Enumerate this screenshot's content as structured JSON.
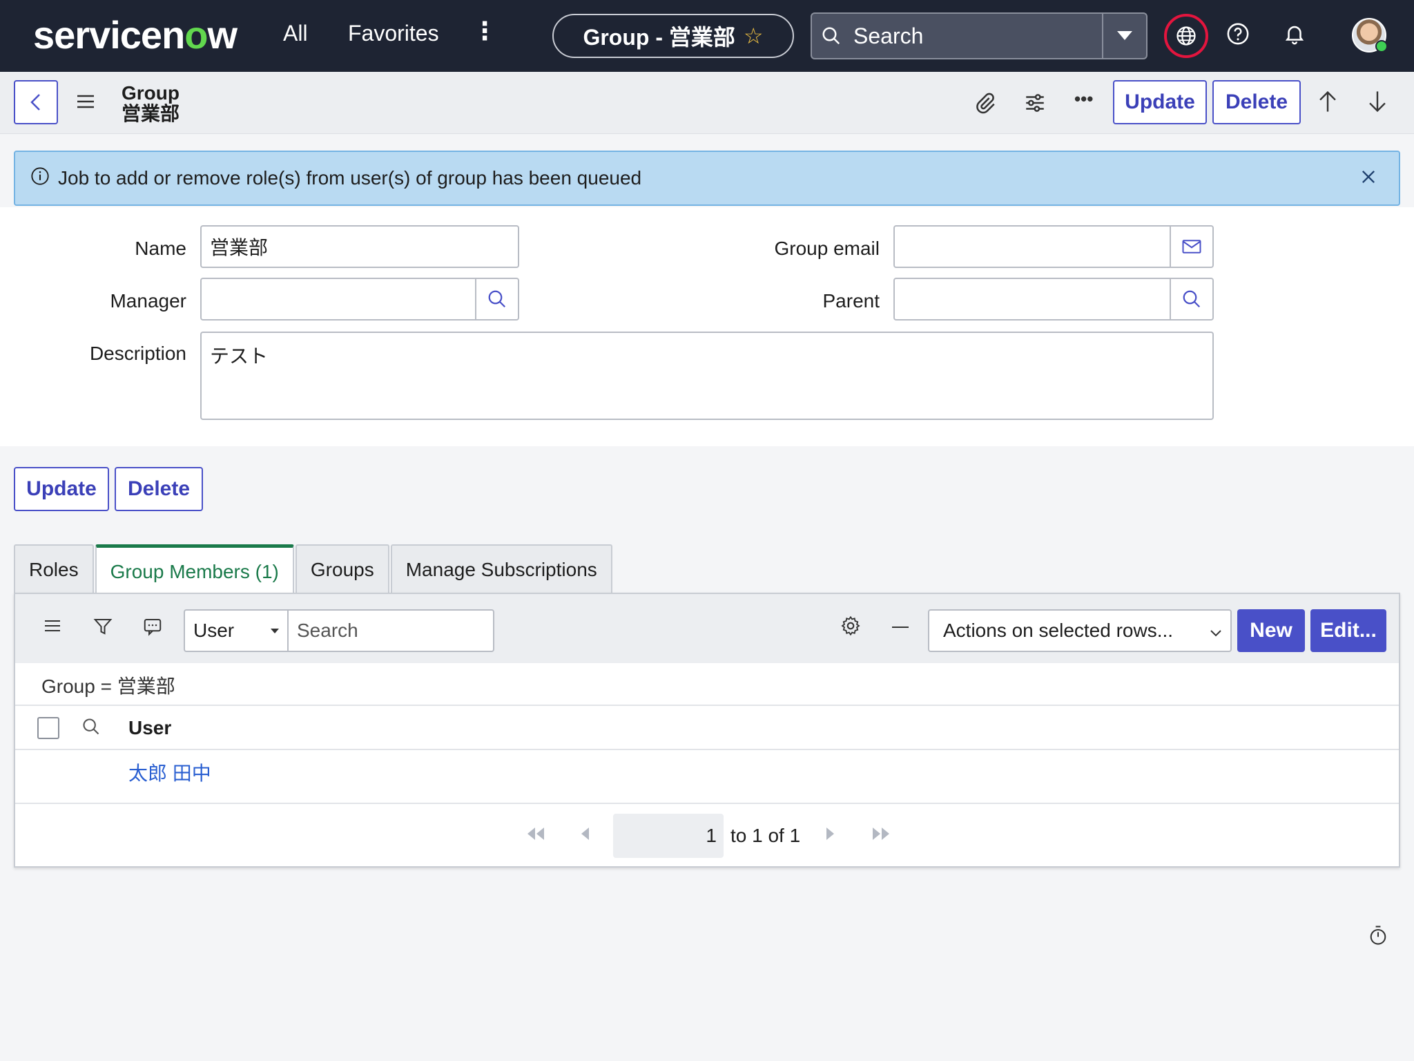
{
  "nav": {
    "logo_pre": "servicen",
    "logo_o": "o",
    "logo_post": "w",
    "all": "All",
    "favorites": "Favorites",
    "more": "⋮",
    "context_title": "Group - 営業部",
    "search_label": "Search"
  },
  "header": {
    "title_line1": "Group",
    "title_line2": "営業部",
    "more": "•••",
    "update": "Update",
    "delete": "Delete"
  },
  "alert": {
    "message": "Job to add or remove role(s) from user(s) of group has been queued"
  },
  "form": {
    "name_label": "Name",
    "name_value": "営業部",
    "manager_label": "Manager",
    "manager_value": "",
    "description_label": "Description",
    "description_value": "テスト",
    "group_email_label": "Group email",
    "group_email_value": "",
    "parent_label": "Parent",
    "parent_value": ""
  },
  "form_actions": {
    "update": "Update",
    "delete": "Delete"
  },
  "tabs": [
    {
      "label": "Roles",
      "active": false
    },
    {
      "label": "Group Members (1)",
      "active": true
    },
    {
      "label": "Groups",
      "active": false
    },
    {
      "label": "Manage Subscriptions",
      "active": false
    }
  ],
  "related_list": {
    "field_select": "User",
    "search_placeholder": "Search",
    "actions_select": "Actions on selected rows...",
    "new": "New",
    "edit": "Edit...",
    "breadcrumb": "Group = 営業部",
    "column_user": "User",
    "rows": [
      {
        "user": "太郎 田中"
      }
    ],
    "pager_page": "1",
    "pager_text": "to 1 of 1"
  },
  "colors": {
    "nav_bg": "#1e2433",
    "accent": "#4950c8",
    "active_tab": "#1a7a4a",
    "alert_bg": "#b9daf2",
    "link": "#2a5fd1"
  }
}
